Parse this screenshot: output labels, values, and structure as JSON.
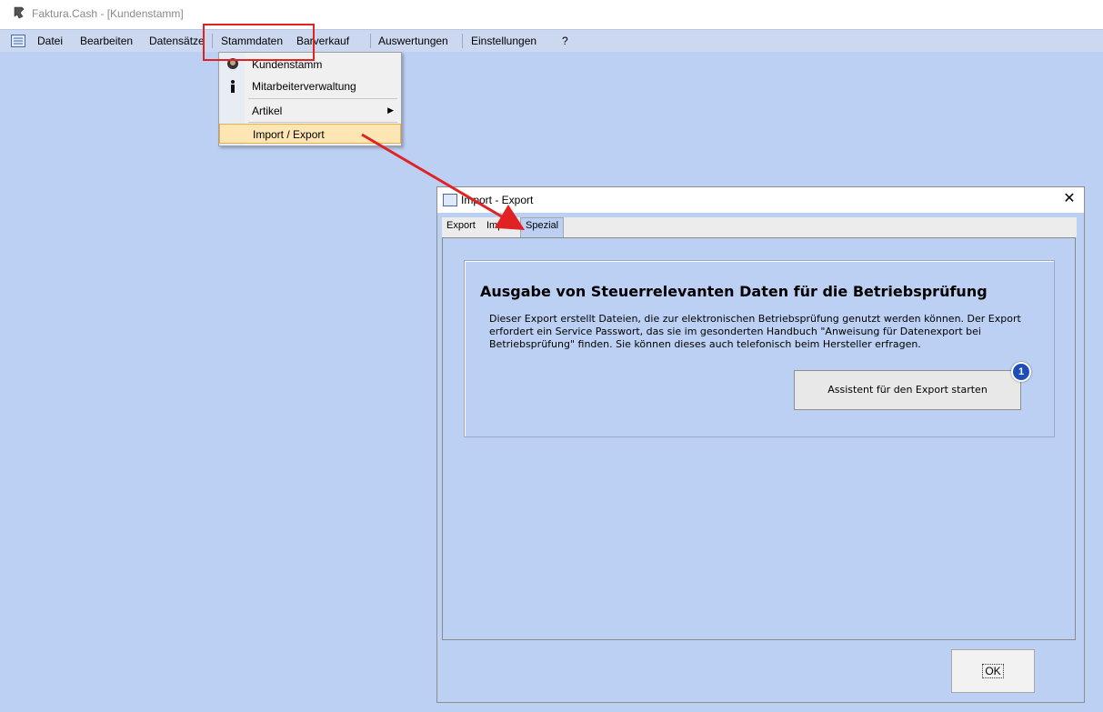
{
  "window": {
    "title": "Faktura.Cash - [Kundenstamm]"
  },
  "menubar": {
    "items": [
      {
        "label": "Datei"
      },
      {
        "label": "Bearbeiten"
      },
      {
        "label": "Datensätze"
      },
      {
        "label": "Stammdaten"
      },
      {
        "label": "Barverkauf"
      },
      {
        "label": "Auswertungen"
      },
      {
        "label": "Einstellungen"
      },
      {
        "label": "?"
      }
    ]
  },
  "dropdown": {
    "items": [
      {
        "label": "Kundenstamm",
        "icon": "customer-icon"
      },
      {
        "label": "Mitarbeiterverwaltung",
        "icon": "person-icon"
      },
      {
        "label": "Artikel",
        "has_submenu": true
      },
      {
        "label": "Import / Export",
        "highlighted": true
      }
    ]
  },
  "dialog": {
    "title": "Import - Export",
    "close_label": "✕",
    "tabs": [
      {
        "label": "Export"
      },
      {
        "label": "Import"
      },
      {
        "label": "Spezial",
        "selected": true
      }
    ],
    "section_title": "Ausgabe von Steuerrelevanten Daten für die Betriebsprüfung",
    "section_text": "Dieser Export erstellt Dateien, die zur elektronischen Betriebsprüfung genutzt werden können. Der Export erfordert ein Service Passwort, das sie im gesonderten Handbuch \"Anweisung für Datenexport bei Betriebsprüfung\" finden. Sie können dieses auch telefonisch beim Hersteller erfragen.",
    "export_button": "Assistent für den Export starten",
    "badge": "1",
    "ok_button": "OK"
  },
  "colors": {
    "mdi_background": "#bcd0f3",
    "menubar": "#ccd8f0",
    "annotation_red": "#e02222",
    "badge_blue": "#1f4db8",
    "active_item": "#fde6b4"
  }
}
